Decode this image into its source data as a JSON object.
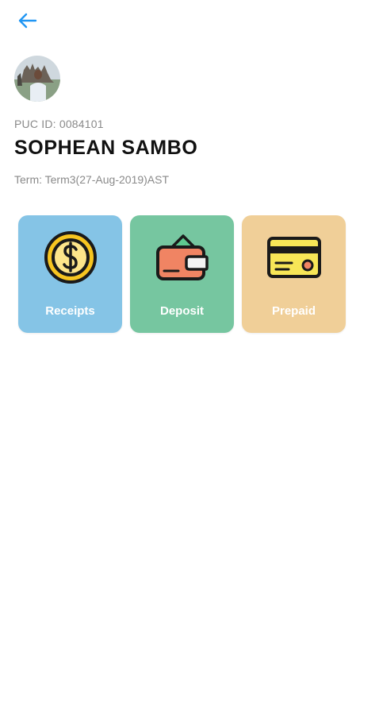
{
  "header": {
    "back_icon": "arrow-left-icon",
    "accent_color": "#2196f3"
  },
  "profile": {
    "puc_id": "PUC ID: 0084101",
    "name": "SOPHEAN SAMBO",
    "term": "Term: Term3(27-Aug-2019)AST"
  },
  "menu": {
    "cards": [
      {
        "label": "Receipts",
        "icon": "dollar-coin-icon",
        "color": "#85c4e6"
      },
      {
        "label": "Deposit",
        "icon": "wallet-icon",
        "color": "#76c6a0"
      },
      {
        "label": "Prepaid",
        "icon": "credit-card-icon",
        "color": "#f0cf98"
      }
    ]
  }
}
